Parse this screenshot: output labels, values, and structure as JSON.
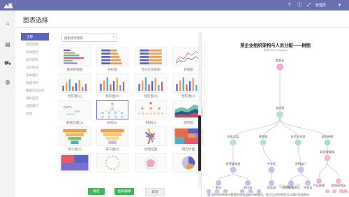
{
  "header": {
    "user": "管理员",
    "icons": [
      "help-icon",
      "info-icon",
      "expand-icon",
      "user-menu-icon"
    ]
  },
  "left_nav": [
    "home-icon",
    "book-icon",
    "cart-icon",
    "globe-icon"
  ],
  "page": {
    "title": "图表选择"
  },
  "categories": [
    {
      "label": "全部",
      "active": true
    },
    {
      "label": "比较类图"
    },
    {
      "label": "时间趋势"
    },
    {
      "label": "层次结构"
    },
    {
      "label": "占比构成"
    },
    {
      "label": "文本展示"
    },
    {
      "label": "地理分布"
    },
    {
      "label": "数据流向分析"
    },
    {
      "label": "指标监控"
    },
    {
      "label": "进度展示"
    },
    {
      "label": "其他"
    }
  ],
  "search": {
    "placeholder": "搜索组件图形"
  },
  "charts": [
    {
      "label": "数据转换图",
      "type": "bar-horizontal"
    },
    {
      "label": "条形图",
      "type": "stacked-bar"
    },
    {
      "label": "百分比条形图",
      "type": "percent-bar"
    },
    {
      "label": "折线图",
      "type": "line"
    },
    {
      "label": "柱形图(1)",
      "type": "column"
    },
    {
      "label": "柱形图(2)",
      "type": "column2"
    },
    {
      "label": "柱形图(3)",
      "type": "column3"
    },
    {
      "label": "柱形图(4)",
      "type": "column4"
    },
    {
      "label": "数据云图(1)",
      "type": "wordcloud"
    },
    {
      "label": "树图(1)",
      "type": "tree",
      "selected": true
    },
    {
      "label": "树图(2)",
      "type": "tree2"
    },
    {
      "label": "面积图",
      "type": "stacked-area"
    },
    {
      "label": "漏斗图(1)",
      "type": "funnel"
    },
    {
      "label": "漏斗图(2)",
      "type": "funnel2"
    },
    {
      "label": "玫瑰花图",
      "type": "rose"
    },
    {
      "label": "矩形树图",
      "type": "treemap"
    },
    {
      "label": "",
      "type": "block"
    },
    {
      "label": "",
      "type": "dots"
    },
    {
      "label": "",
      "type": "radar"
    },
    {
      "label": "",
      "type": "pie"
    }
  ],
  "buttons": {
    "confirm": "确定",
    "advanced": "图表编辑",
    "cancel": "取消"
  },
  "preview": {
    "title": "某企业组织架构与人员分配——树图",
    "subtitle": "来源:SaCo DataViz",
    "root": "董事长",
    "level2": "总经理",
    "level3": [
      "财务总监",
      "营销部",
      "技术开发部",
      "副总经理"
    ],
    "level4": [
      "经营管理部",
      "中华区",
      "采购部门",
      "研发管理部"
    ],
    "level5": [
      "审计",
      "审计部",
      "财务部",
      "物资储备中心",
      "开发员",
      "产品经理",
      "管理采购区"
    ],
    "leaves": [
      "财务",
      "管理",
      "人事",
      "人事",
      "合同",
      "后勤",
      "财务",
      "产品",
      "财务",
      "人事"
    ],
    "footer": "通过树形结构显示数据的结构层级分配情况，结点之间的关系可以通过连线表示"
  },
  "watermark": "Baidu经验",
  "colors": {
    "header": "#6a6fb0",
    "accent": "#5b63c1",
    "confirm_button": "#3cb855",
    "advanced_button": "#3cb855",
    "cancel_button": "#f0f0f0",
    "node_root": "#f4a7cf",
    "node_level": "#b5e4c5",
    "node_teal": "#a6dfd7",
    "node_purple": "#c5c0f0",
    "node_pink": "#f6b7d7"
  }
}
